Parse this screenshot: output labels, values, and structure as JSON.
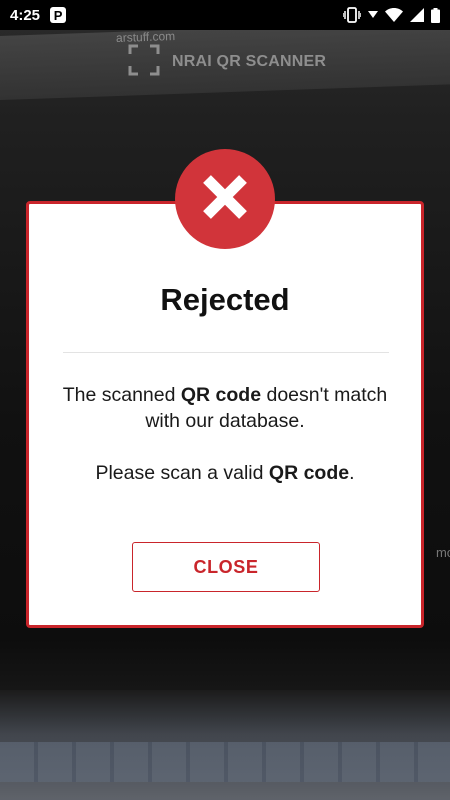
{
  "status_bar": {
    "time": "4:25",
    "app_icon_letter": "P",
    "icons": [
      "vibrate-icon",
      "signal-dropdown-icon",
      "wifi-icon",
      "cellular-icon",
      "battery-icon"
    ]
  },
  "scanner": {
    "title": "NRAI QR SCANNER",
    "icon": "qr-scan-frame-icon"
  },
  "background_text": {
    "top": "arstuff.com",
    "side": "mo"
  },
  "dialog": {
    "badge_icon": "close-x-icon",
    "title": "Rejected",
    "message_line1_pre": "The scanned ",
    "message_line1_bold": "QR code",
    "message_line1_post": " doesn't match with our database.",
    "message_line2_pre": "Please scan a valid ",
    "message_line2_bold": "QR code",
    "message_line2_post": ".",
    "close_label": "CLOSE"
  },
  "colors": {
    "accent_red": "#c9252b",
    "badge_red": "#d1343a"
  }
}
